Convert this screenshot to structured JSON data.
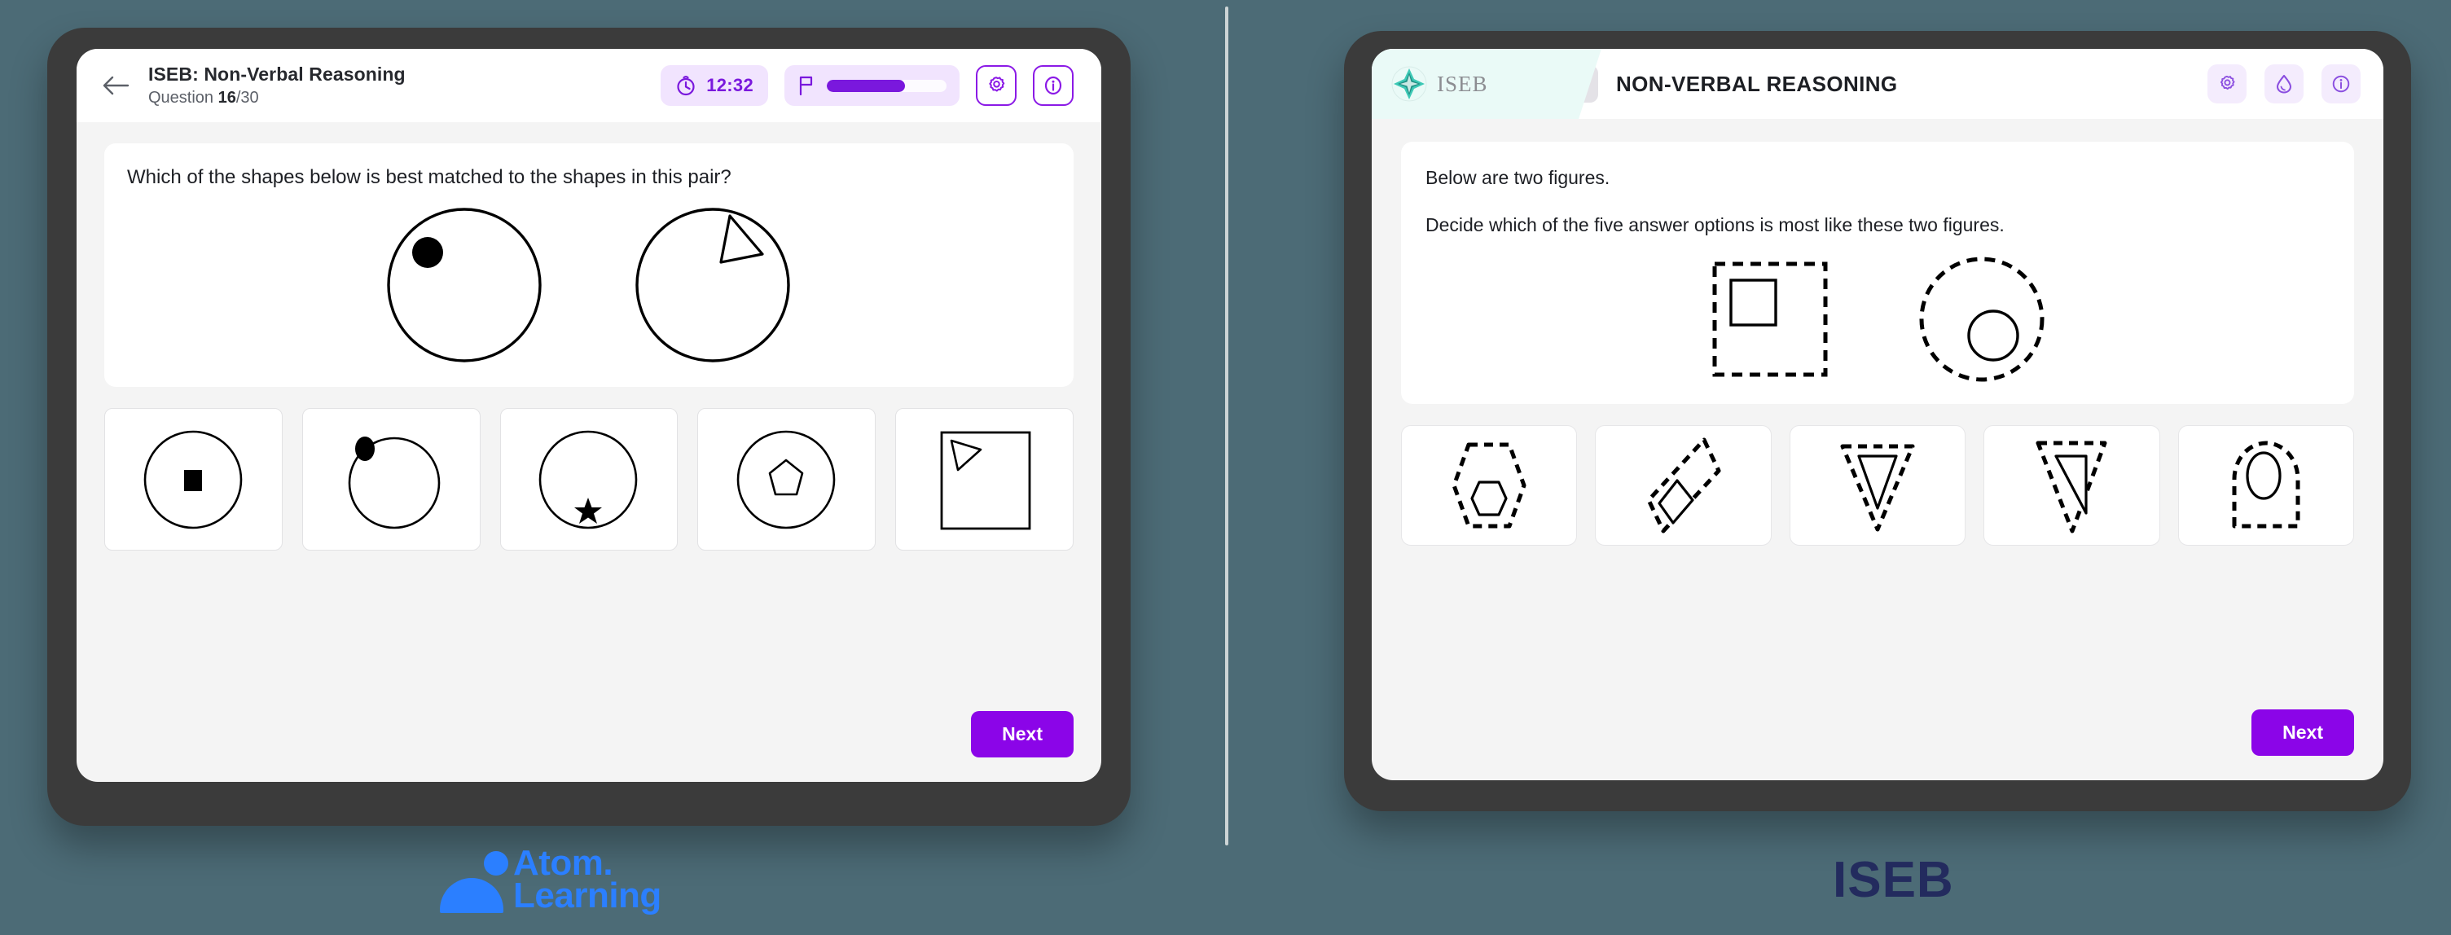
{
  "background": {
    "color": "#4c6b76",
    "divider_color": "#cdd5d6"
  },
  "colors": {
    "atom_purple": "#8b05e8",
    "atom_purple_light": "#f1e4fe",
    "atom_blue": "#2b7fff",
    "iseb_navy": "#232b5e",
    "iseb_teal": "#2ec4b0",
    "bezel": "#3b3b3b",
    "screen_bg": "#f4f4f4"
  },
  "left_panel": {
    "header": {
      "back_icon": "arrow-left-icon",
      "title": "ISEB: Non-Verbal Reasoning",
      "subtitle_prefix": "Question ",
      "subtitle_current": "16",
      "subtitle_suffix": "/30",
      "timer_icon": "stopwatch-icon",
      "timer_value": "12:32",
      "flag_icon": "flag-icon",
      "progress_percent": 65,
      "settings_icon": "gear-icon",
      "info_icon": "info-icon"
    },
    "question": {
      "prompt": "Which of the shapes below is best matched to the shapes in this pair?",
      "stimulus": [
        {
          "name": "circle-with-filled-dot",
          "outer": "circle",
          "inner": "filled-circle",
          "inner_position": "upper-left"
        },
        {
          "name": "circle-with-triangle",
          "outer": "circle",
          "inner": "outlined-triangle",
          "inner_position": "upper-right"
        }
      ],
      "options": [
        {
          "id": "A",
          "name": "circle-with-filled-square",
          "outer": "circle",
          "inner": "filled-square"
        },
        {
          "id": "B",
          "name": "circle-with-filled-dot-on-edge",
          "outer": "circle",
          "inner": "filled-circle"
        },
        {
          "id": "C",
          "name": "circle-with-filled-star",
          "outer": "circle",
          "inner": "filled-star"
        },
        {
          "id": "D",
          "name": "circle-with-pentagon",
          "outer": "circle",
          "inner": "outlined-pentagon"
        },
        {
          "id": "E",
          "name": "square-with-triangle",
          "outer": "square",
          "inner": "outlined-triangle"
        }
      ]
    },
    "next_label": "Next"
  },
  "right_panel": {
    "header": {
      "logo_text": "ISEB",
      "logo_icon": "iseb-star-logo",
      "back_icon": "chevron-left-icon",
      "title": "NON-VERBAL REASONING",
      "settings_icon": "gear-icon",
      "contrast_icon": "water-drop-icon",
      "info_icon": "info-icon"
    },
    "question": {
      "line1": "Below are two figures.",
      "line2": "Decide which of the five answer options is most like these two figures.",
      "stimulus": [
        {
          "name": "dashed-square-with-square",
          "outer": "dashed-square",
          "inner": "solid-square",
          "inner_position": "upper-left"
        },
        {
          "name": "dashed-circle-with-circle",
          "outer": "dashed-circle",
          "inner": "solid-circle",
          "inner_position": "lower-right"
        }
      ],
      "options": [
        {
          "id": "A",
          "name": "dashed-hexagon-with-hexagon",
          "outer": "dashed-hexagon",
          "inner": "solid-hexagon"
        },
        {
          "id": "B",
          "name": "dashed-diamond-with-diamond",
          "outer": "dashed-diamond",
          "inner": "solid-diamond"
        },
        {
          "id": "C",
          "name": "dashed-triangle-with-triangle",
          "outer": "dashed-triangle",
          "inner": "solid-triangle"
        },
        {
          "id": "D",
          "name": "dashed-narrow-triangle-with-triangle",
          "outer": "dashed-triangle",
          "inner": "solid-triangle"
        },
        {
          "id": "E",
          "name": "dashed-arch-with-ellipse",
          "outer": "dashed-arch",
          "inner": "solid-ellipse"
        }
      ]
    },
    "next_label": "Next"
  },
  "footer": {
    "atom_logo_line1": "Atom.",
    "atom_logo_line2": "Learning",
    "iseb_logo": "ISEB"
  }
}
